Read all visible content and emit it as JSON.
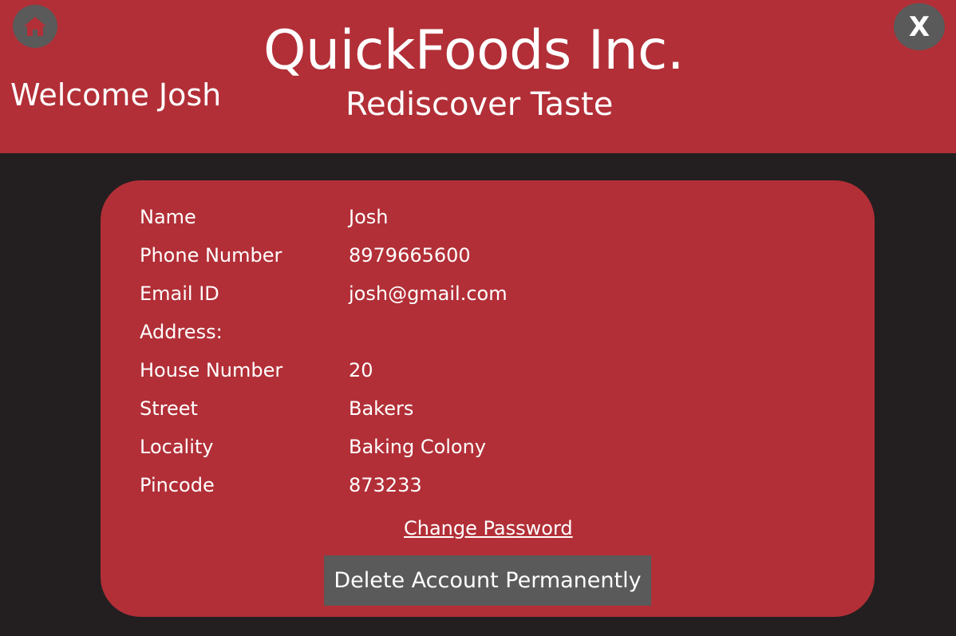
{
  "header": {
    "brand_title": "QuickFoods Inc.",
    "tagline": "Rediscover Taste",
    "welcome_text": "Welcome Josh",
    "home_icon": "home-icon",
    "close_label": "X"
  },
  "profile": {
    "rows": [
      {
        "label": "Name",
        "value": "Josh"
      },
      {
        "label": "Phone Number",
        "value": "8979665600"
      },
      {
        "label": "Email ID",
        "value": "josh@gmail.com"
      },
      {
        "label": "Address:",
        "value": ""
      },
      {
        "label": "House Number",
        "value": "20"
      },
      {
        "label": "Street",
        "value": "Bakers"
      },
      {
        "label": "Locality",
        "value": "Baking Colony"
      },
      {
        "label": "Pincode",
        "value": "873233"
      }
    ],
    "change_password_label": "Change Password",
    "delete_account_label": "Delete Account Permanently"
  },
  "colors": {
    "brand_red": "#b22f37",
    "background_dark": "#231f20",
    "button_gray": "#5a5a5a",
    "text": "#ffffff"
  }
}
